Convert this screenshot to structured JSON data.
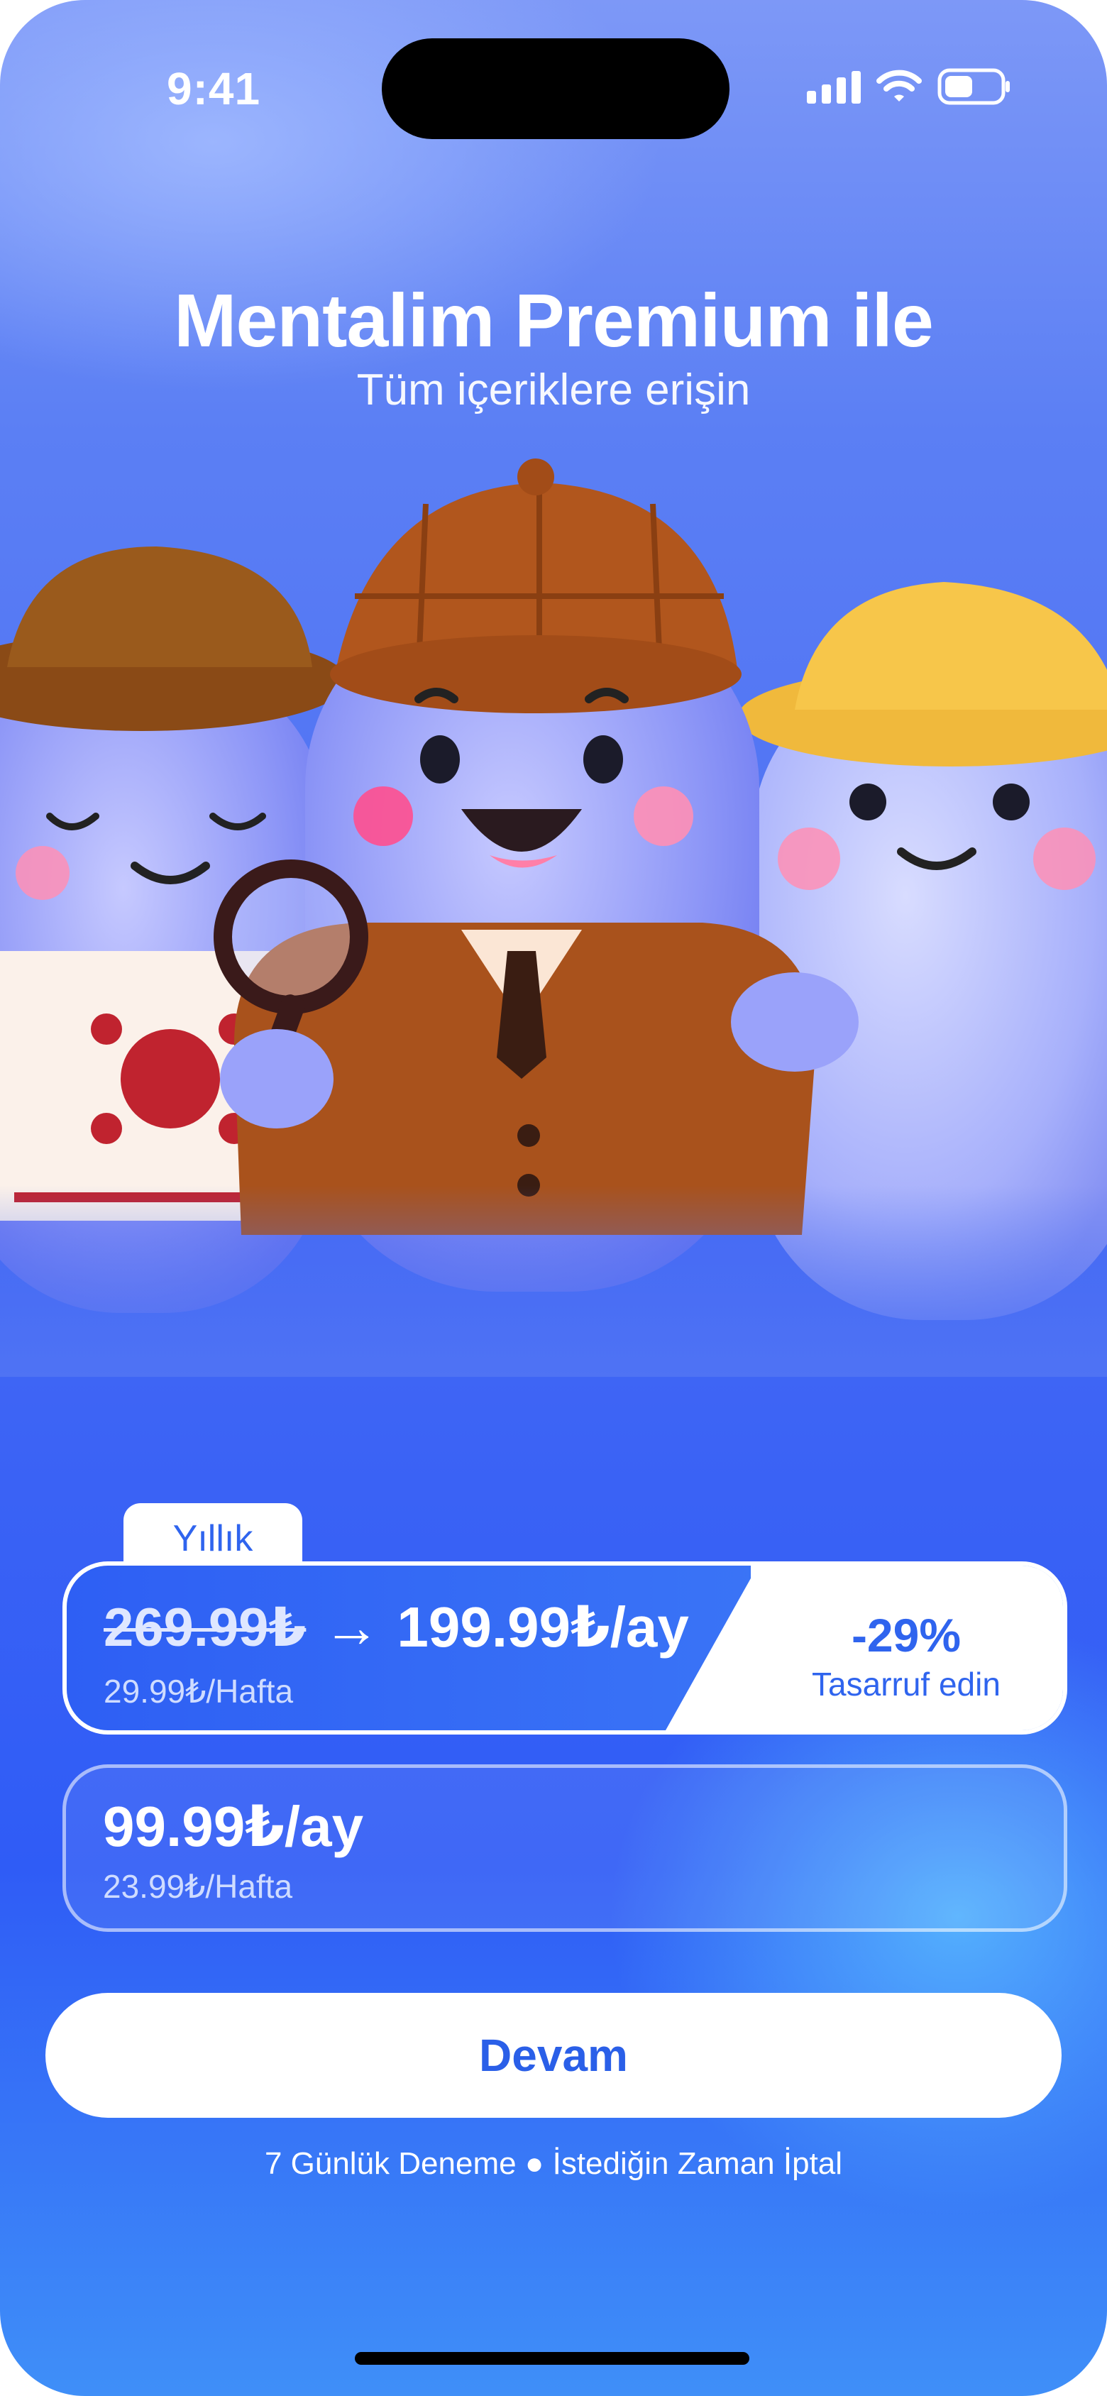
{
  "status_bar": {
    "time": "9:41"
  },
  "header": {
    "title": "Mentalim Premium ile",
    "subtitle": "Tüm içeriklere erişin"
  },
  "plans": {
    "annual": {
      "tab_label": "Yıllık",
      "old_price": "269.99₺",
      "arrow": "→",
      "price": "199.99₺/ay",
      "weekly": "29.99₺/Hafta",
      "discount": "-29%",
      "discount_label": "Tasarruf edin"
    },
    "monthly": {
      "price": "99.99₺/ay",
      "weekly": "23.99₺/Hafta"
    }
  },
  "cta": {
    "label": "Devam"
  },
  "footer": {
    "text": "7 Günlük Deneme ● İstediğin Zaman İptal"
  },
  "colors": {
    "accent": "#2f64ee",
    "background_top": "#7d98f7",
    "background_bottom": "#3f8ff8"
  },
  "icons": [
    "cellular-signal-icon",
    "wifi-icon",
    "battery-icon"
  ]
}
